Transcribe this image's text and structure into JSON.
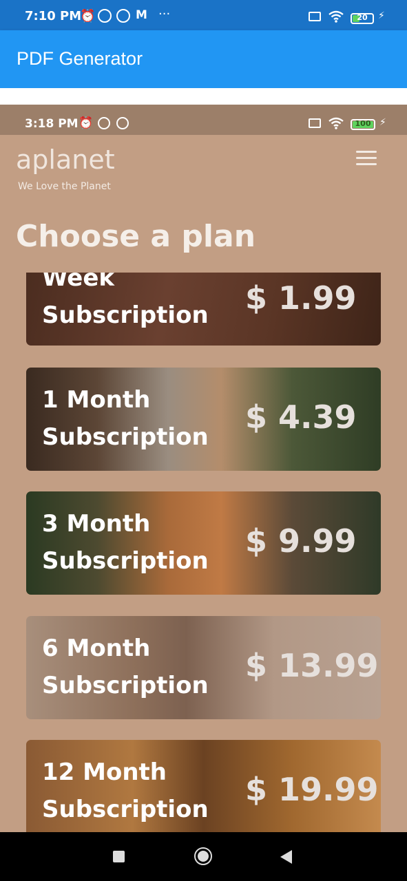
{
  "system_status": {
    "time": "7:10 PM",
    "battery": "20"
  },
  "app_bar": {
    "title": "PDF Generator"
  },
  "inner_status": {
    "time": "3:18 PM",
    "battery": "100"
  },
  "header": {
    "brand": "aplanet",
    "tagline": "We Love the Planet",
    "menu_icon": "hamburger-menu-icon"
  },
  "page": {
    "heading": "Choose a plan"
  },
  "plans": [
    {
      "name_line1": "Week",
      "name_line2": "Subscription",
      "price": "$ 1.99"
    },
    {
      "name_line1": "1 Month",
      "name_line2": "Subscription",
      "price": "$ 4.39"
    },
    {
      "name_line1": "3 Month",
      "name_line2": "Subscription",
      "price": "$ 9.99"
    },
    {
      "name_line1": "6 Month",
      "name_line2": "Subscription",
      "price": "$ 13.99"
    },
    {
      "name_line1": "12 Month",
      "name_line2": "Subscription",
      "price": "$ 19.99"
    }
  ],
  "colors": {
    "app_bar": "#2196f3",
    "status_bar": "#1a73c7",
    "page_background": "#c29e84"
  }
}
